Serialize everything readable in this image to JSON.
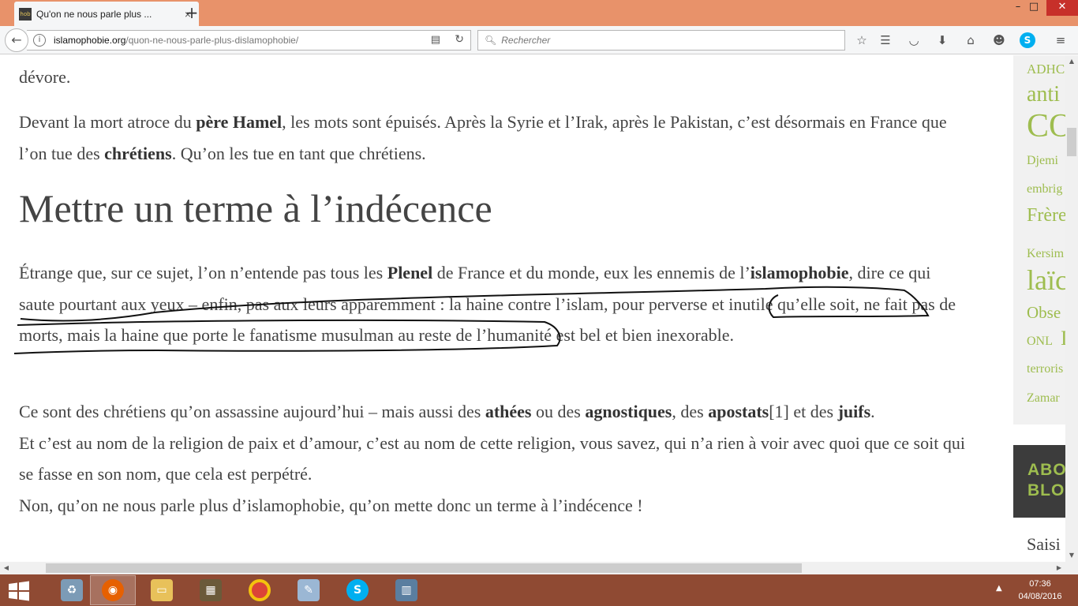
{
  "browser": {
    "tab_title": "Qu'on ne nous parle plus ...",
    "favicon_text": "hob",
    "new_tab_label": "+",
    "close_tab_label": "×",
    "url_domain": "islamophobie.org",
    "url_path": "/quon-ne-nous-parle-plus-dislamophobie/",
    "search_placeholder": "Rechercher",
    "window_controls": {
      "minimize": "–",
      "maximize": "□",
      "close": "✕"
    }
  },
  "article": {
    "p_devore": "dévore.",
    "p_hamel": {
      "t1": "Devant la mort atroce du ",
      "b1": "père Hamel",
      "t2": ", les mots sont épuisés. Après la Syrie et l’Irak, après le Pakistan, c’est désormais en France que l’on tue des ",
      "b2": "chrétiens",
      "t3": ". Qu’on les tue en tant que chrétiens."
    },
    "heading": "Mettre un terme à l’indécence",
    "p_etrange": {
      "t1": "Étrange que, sur ce sujet, l’on n’entende pas tous les ",
      "b1": "Plenel",
      "t2": " de France et du monde, eux les ennemis de l’",
      "b2": "islamophobie",
      "t3": ", dire ce qui saute pourtant aux yeux – enfin, pas aux leurs apparemment : la haine contre l’islam, pour perverse et inutile qu’elle soit, ne fait pas de morts, mais la haine que porte le fanatisme musulman au reste de l’humanité est bel et bien inexorable."
    },
    "p_chretiens": {
      "t1": "Ce sont des chrétiens qu’on assassine aujourd’hui – mais aussi des ",
      "b1": "athées",
      "t2": " ou des ",
      "b2": "agnostiques",
      "t3": ", des ",
      "b3": "apostats",
      "t4": "[1] et des ",
      "b4": "juifs",
      "t5": ".",
      "line2": "Et c’est au nom de la religion de paix et d’amour, c’est au nom de cette religion, vous savez, qui n’a rien à voir avec quoi que ce soit qui se fasse en son nom, que cela est perpétré.",
      "line3": "Non, qu’on ne nous parle plus d’islamophobie, qu’on mette donc un terme à l’indécence !"
    }
  },
  "sidebar": {
    "tags": [
      "ADHC",
      "anti",
      "CO",
      "Djemi",
      "embrig",
      "Frère",
      "Kersim",
      "laïc",
      "Obse",
      "ONL",
      "I",
      "terroris",
      "Zamar"
    ],
    "about_line1": "ABO",
    "about_line2": "BLO",
    "search_label": "Saisi"
  },
  "taskbar": {
    "time": "07:36",
    "date": "04/08/2016",
    "tray_arrow": "▲"
  },
  "colors": {
    "titlebar": "#e8926a",
    "tag_green": "#9ebd4f",
    "taskbar": "#8f4a33",
    "annotation_ink": "#111111"
  }
}
